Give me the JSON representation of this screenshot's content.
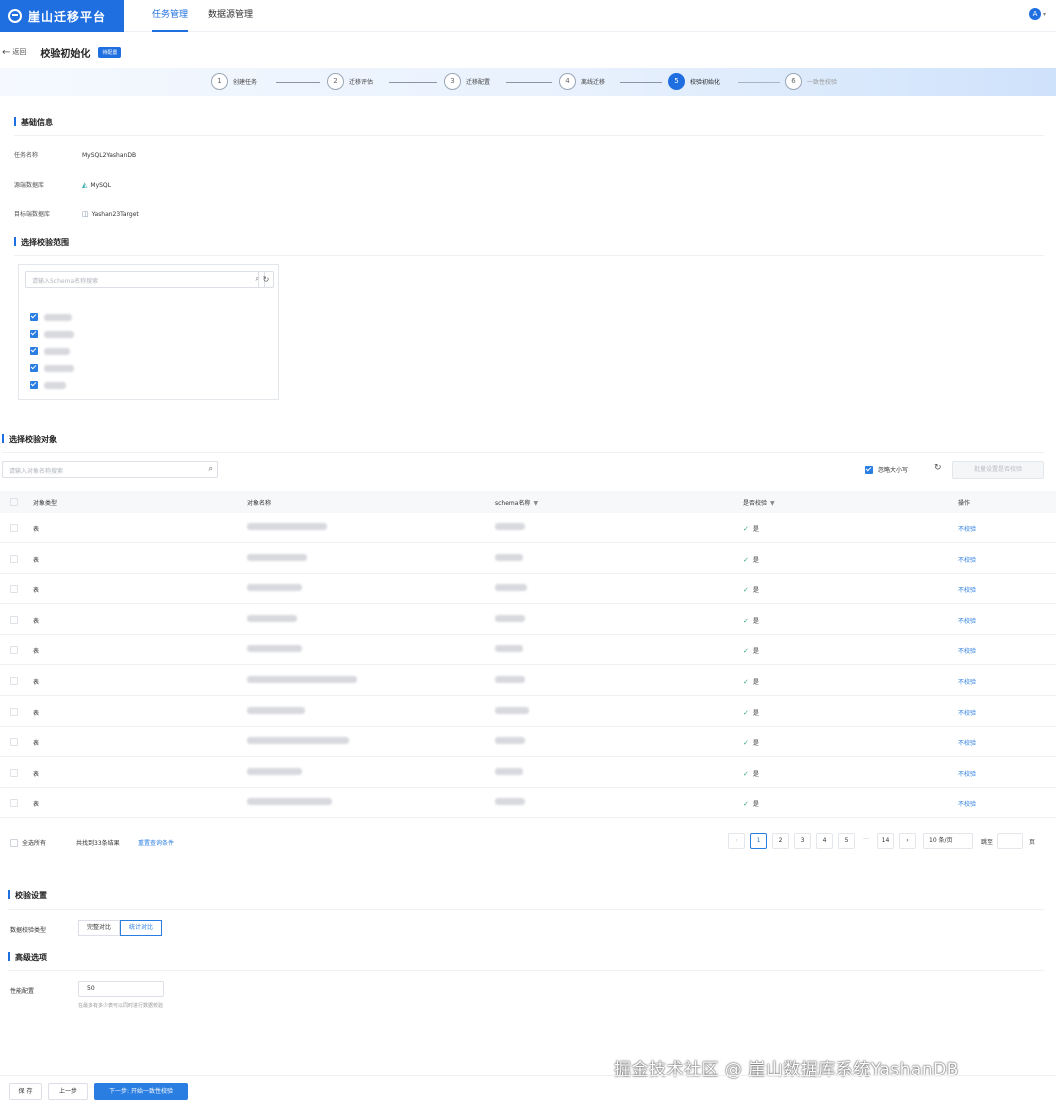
{
  "app": {
    "brand": "崖山迁移平台"
  },
  "nav": {
    "tabs": [
      "任务管理",
      "数据源管理"
    ],
    "active_tab": 0
  },
  "user": {
    "avatar_letter": "A"
  },
  "header": {
    "back_label": "返回",
    "title": "校验初始化",
    "badge": "待配置"
  },
  "steps": [
    {
      "num": "1",
      "label": "创建任务",
      "state": "done"
    },
    {
      "num": "2",
      "label": "迁移评估",
      "state": "done"
    },
    {
      "num": "3",
      "label": "迁移配置",
      "state": "done"
    },
    {
      "num": "4",
      "label": "离线迁移",
      "state": "done"
    },
    {
      "num": "5",
      "label": "校验初始化",
      "state": "active"
    },
    {
      "num": "6",
      "label": "一致性校验",
      "state": "pending"
    }
  ],
  "basic": {
    "title": "基础信息",
    "task_name_label": "任务名称",
    "task_name": "MySQL2YashanDB",
    "source_label": "源端数据库",
    "source": "MySQL",
    "target_label": "目标端数据库",
    "target": "Yashan23Target"
  },
  "scope": {
    "title": "选择校验范围",
    "search_placeholder": "请输入Schema名称搜索",
    "items": [
      {
        "checked": true
      },
      {
        "checked": true
      },
      {
        "checked": true
      },
      {
        "checked": true
      },
      {
        "checked": true
      }
    ]
  },
  "objects": {
    "title": "选择校验对象",
    "search_placeholder": "请输入对象名称搜索",
    "ignore_case_label": "忽略大小写",
    "batch_button": "批量设置是否校验",
    "columns": {
      "type": "对象类型",
      "name": "对象名称",
      "schema": "schema名称",
      "verify": "是否校验",
      "op": "操作"
    },
    "rows": [
      {
        "type": "表",
        "verify": "是",
        "op": "不校验"
      },
      {
        "type": "表",
        "verify": "是",
        "op": "不校验"
      },
      {
        "type": "表",
        "verify": "是",
        "op": "不校验"
      },
      {
        "type": "表",
        "verify": "是",
        "op": "不校验"
      },
      {
        "type": "表",
        "verify": "是",
        "op": "不校验"
      },
      {
        "type": "表",
        "verify": "是",
        "op": "不校验"
      },
      {
        "type": "表",
        "verify": "是",
        "op": "不校验"
      },
      {
        "type": "表",
        "verify": "是",
        "op": "不校验"
      },
      {
        "type": "表",
        "verify": "是",
        "op": "不校验"
      },
      {
        "type": "表",
        "verify": "是",
        "op": "不校验"
      }
    ],
    "select_all_label": "全选所有",
    "found_text": "共找到33条结果",
    "reset_label": "重置查询条件",
    "pagination": {
      "prev": "‹",
      "pages": [
        "1",
        "2",
        "3",
        "4",
        "5"
      ],
      "dots": "···",
      "last": "14",
      "next": "›",
      "page_size": "10 条/页",
      "jump_label": "跳至",
      "page_unit": "页"
    }
  },
  "verify_settings": {
    "title": "校验设置",
    "mode_label": "数据校验类型",
    "modes": [
      "完整对比",
      "统计对比"
    ],
    "active_mode": 1
  },
  "advanced": {
    "title": "高级选项",
    "perf_label": "性能配置",
    "perf_value": "50",
    "perf_hint": "在最多有多少表可以同时进行数据校验"
  },
  "footer": {
    "save": "保 存",
    "prev": "上一步",
    "next": "下一步: 开始一致性校验"
  },
  "watermark": "掘金技术社区 @ 崖山数据库系统YashanDB"
}
